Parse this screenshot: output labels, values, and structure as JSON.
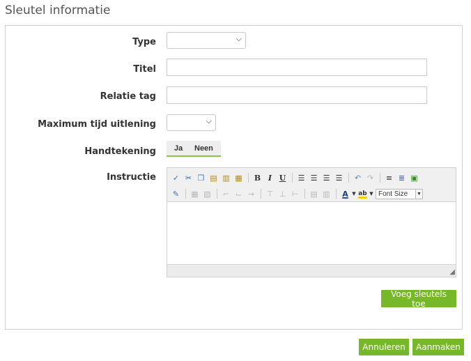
{
  "page": {
    "title": "Sleutel informatie"
  },
  "form": {
    "type_label": "Type",
    "type_value": "",
    "titel_label": "Titel",
    "titel_value": "",
    "relatie_label": "Relatie tag",
    "relatie_value": "",
    "max_tijd_label": "Maximum tijd uitlening",
    "max_tijd_value": "",
    "handtekening_label": "Handtekening",
    "handtekening_options": [
      "Ja",
      "Neen"
    ],
    "instructie_label": "Instructie"
  },
  "editor": {
    "font_size_label": "Font Size",
    "bold": "B",
    "italic": "I",
    "underline": "U",
    "font_color": "A",
    "highlight": "ab"
  },
  "buttons": {
    "add_keys": "Voeg sleutels toe",
    "cancel": "Annuleren",
    "create": "Aanmaken"
  },
  "colors": {
    "accent_green": "#76b82a"
  }
}
